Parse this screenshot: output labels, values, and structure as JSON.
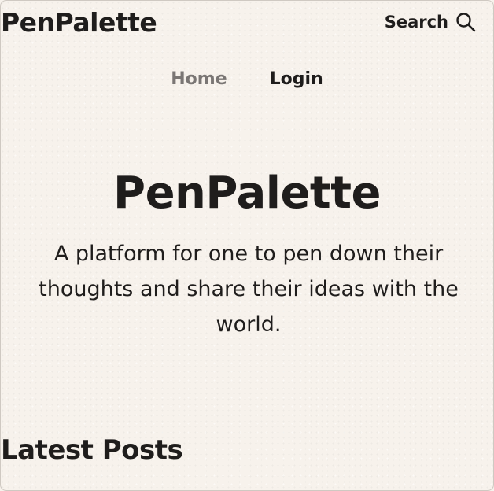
{
  "header": {
    "brand": "PenPalette",
    "search_label": "Search",
    "search_icon": "search-icon"
  },
  "nav": {
    "items": [
      {
        "label": "Home",
        "color": "#7a7674"
      },
      {
        "label": "Login",
        "color": "#1f1d1c"
      }
    ]
  },
  "hero": {
    "title": "PenPalette",
    "subtitle": "A platform for one to pen down their thoughts and share their ideas with the world."
  },
  "sections": {
    "latest_posts_heading": "Latest Posts"
  },
  "colors": {
    "background": "#f7f2ec",
    "text": "#1f1d1c",
    "muted": "#7a7674"
  }
}
